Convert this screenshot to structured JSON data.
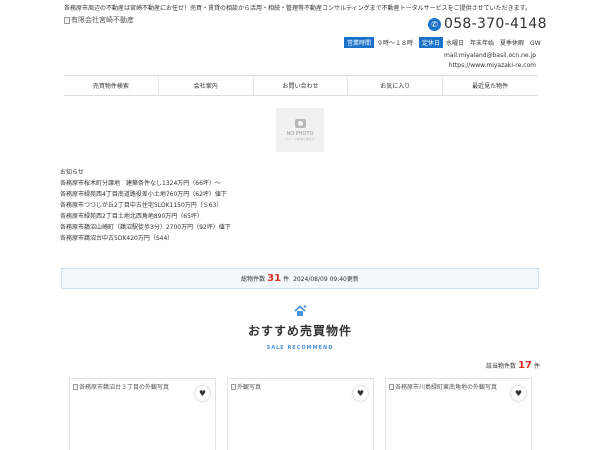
{
  "header": {
    "tagline": "各務原市周辺の不動産は宮崎不動産にお任せ！売買・賃貸の相談から活用・相続・管理等不動産コンサルティングまで不動産トータルサービスをご提供させていただきます。",
    "logo_alt": "有限会社宮崎不動産",
    "phone": "058-370-4148",
    "hours_tag": "営業時間",
    "hours_value": "９時～１８時",
    "closed_tag": "定休日",
    "closed_value": "水曜日　年末年始　夏季休暇　GW",
    "mail": "mail:miyaland@basil.ocn.ne.jp",
    "url": "https://www.miyazaki-re.com"
  },
  "nav": {
    "items": [
      {
        "label": "売買物件検索"
      },
      {
        "label": "会社案内"
      },
      {
        "label": "お問い合わせ"
      },
      {
        "label": "お気に入り"
      },
      {
        "label": "最近見た物件"
      }
    ]
  },
  "nophoto": {
    "title": "NO PHOTO",
    "subtitle": "イメージがありません"
  },
  "news": {
    "title": "お知らせ",
    "lines": [
      "各務原市桜木町分譲地　建築条件なし1324万円（66坪）～",
      "各務原市緑苑西4丁目南道路役差小土地760万円（62坪）値下",
      "各務原市つつじが丘2丁目中古住宅5LDK1150万円（Ｓ63）",
      "各務原市緑苑西2丁目土地北西角地890万円（65坪）",
      "各務原市鵜沼山崎町（鵜沼駅徒歩3分）2700万円（92坪）値下",
      "各務原市鵜沼台中古5DK420万円（S44）"
    ]
  },
  "count": {
    "label": "総物件数",
    "value": "31",
    "unit": "件",
    "updated": "2024/08/09 09:40更新"
  },
  "recommend": {
    "title": "おすすめ売買物件",
    "subtitle": "SALE RECOMMEND",
    "hits_label": "該当物件数",
    "hits_value": "17",
    "hits_unit": "件",
    "cards": [
      {
        "alt": "各務原市鵜沼台３丁目の外観写真"
      },
      {
        "alt": "外観写真"
      },
      {
        "alt": "各務原市川島緑町東南角地の外観写真"
      }
    ]
  },
  "colors": {
    "accent_blue": "#1b73c9",
    "highlight_red": "#e0301e"
  }
}
